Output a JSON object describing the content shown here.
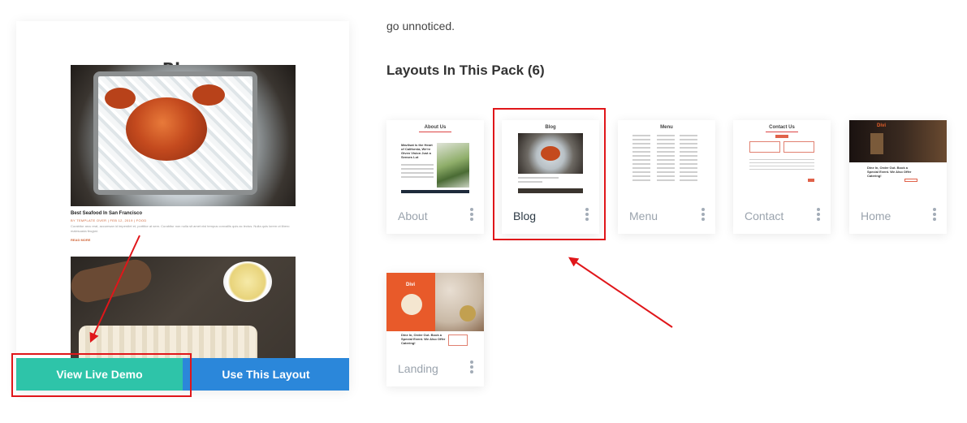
{
  "preview": {
    "title": "Blog",
    "post_title": "Best Seafood In San Francisco",
    "post_meta": "BY TEMPLATE OVER | FEB 12, 2019 | FOOD",
    "post_excerpt": "Curabitur arcu erat, accumsan id imperdiet et, porttitor at sem. Curabitur non nulla sit amet nisl tempus convallis quis ac lectus. Nulla quis lorem ut libero malesuada feugiat.",
    "post_more": "READ MORE",
    "buttons": {
      "demo_label": "View Live Demo",
      "use_label": "Use This Layout"
    }
  },
  "intro_text": "go unnoticed.",
  "pack_heading": "Layouts In This Pack (6)",
  "layouts": [
    {
      "label": "About",
      "thumb_title": "About Us",
      "thumb_text": "Mavilsat is the Heart of California, We're Given Vision Just a Senses Lot"
    },
    {
      "label": "Blog",
      "thumb_title": "Blog"
    },
    {
      "label": "Menu",
      "thumb_title": "Menu"
    },
    {
      "label": "Contact",
      "thumb_title": "Contact Us"
    },
    {
      "label": "Home",
      "thumb_title": "Divi",
      "thumb_text": "Dine In, Order Out. Book a Special Event. We Also Offer Catering!"
    },
    {
      "label": "Landing",
      "thumb_title": "Divi",
      "thumb_text": "Dine In, Order Out. Book a Special Event. We Also Offer Catering!"
    }
  ],
  "colors": {
    "demo_button": "#2ec4a9",
    "use_button": "#2b87da",
    "highlight": "#e0161a",
    "active_label": "#2d3a45",
    "inactive_label": "#9aa3ad"
  },
  "icons": [
    "kebab-menu-icon",
    "arrow-annotation"
  ]
}
